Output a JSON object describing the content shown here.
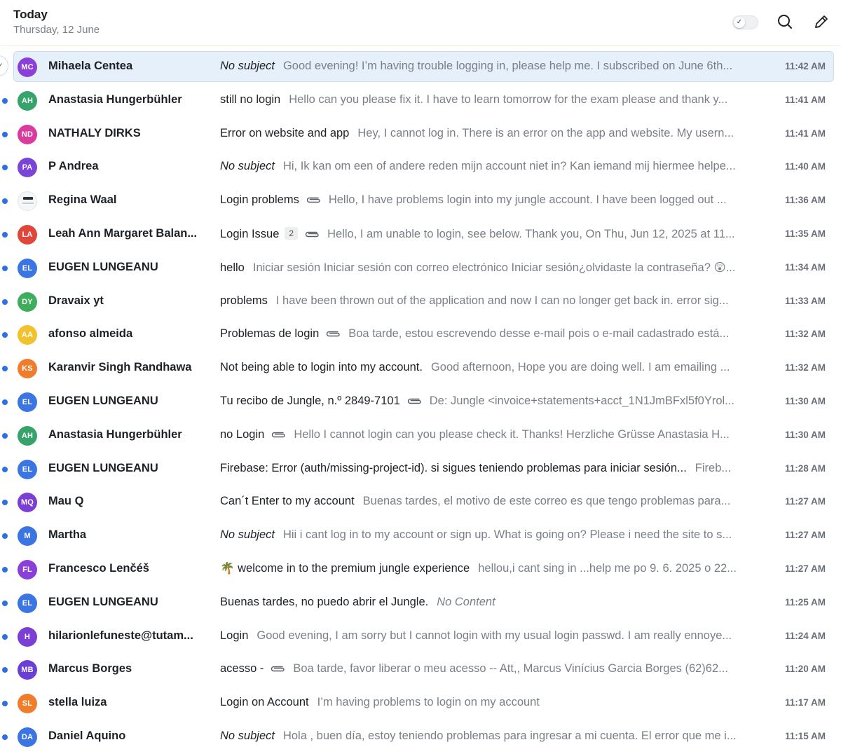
{
  "header": {
    "title": "Today",
    "date": "Thursday, 12 June",
    "toggle_icon": "check-icon",
    "actions": [
      "search-icon",
      "compose-icon"
    ]
  },
  "emails": [
    {
      "initials": "MC",
      "color": "#8b3fd9",
      "sender": "Mihaela Centea",
      "subject": "No subject",
      "subject_italic": true,
      "count": "",
      "attachment": false,
      "preview": "Good evening! I’m having trouble logging in, please help me. I subscribed on June 6th...",
      "time": "11:42 AM",
      "unread": false,
      "selected": true
    },
    {
      "initials": "AH",
      "color": "#35a36a",
      "sender": "Anastasia Hungerbühler",
      "subject": "still no login",
      "subject_italic": false,
      "count": "",
      "attachment": false,
      "preview": "Hello can you please fix it. I have to learn tomorrow for the exam please and thank y...",
      "time": "11:41 AM",
      "unread": true
    },
    {
      "initials": "ND",
      "color": "#d93c9e",
      "sender": "NATHALY DIRKS",
      "subject": "Error on website and app",
      "subject_italic": false,
      "count": "",
      "attachment": false,
      "preview": "Hey, I cannot log in. There is an error on the app and website. My usern...",
      "time": "11:41 AM",
      "unread": true
    },
    {
      "initials": "PA",
      "color": "#7a44d8",
      "sender": "P Andrea",
      "subject": "No subject",
      "subject_italic": true,
      "count": "",
      "attachment": false,
      "preview": "Hi, Ik kan om een of andere reden mijn account niet in? Kan iemand mij hiermee helpe...",
      "time": "11:40 AM",
      "unread": true
    },
    {
      "initials": "",
      "color": "",
      "sender": "Regina Waal",
      "subject": "Login problems",
      "subject_italic": false,
      "count": "",
      "attachment": true,
      "preview": "Hello, I have problems login into my jungle account. I have been logged out ...",
      "time": "11:36 AM",
      "unread": true,
      "avatar_image": true
    },
    {
      "initials": "LA",
      "color": "#e0473a",
      "sender": "Leah Ann Margaret Balan...",
      "subject": "Login Issue",
      "subject_italic": false,
      "count": "2",
      "attachment": true,
      "preview": "Hello, I am unable to login, see below. Thank you, On Thu, Jun 12, 2025 at 11...",
      "time": "11:35 AM",
      "unread": true
    },
    {
      "initials": "EL",
      "color": "#3b74e3",
      "sender": "EUGEN LUNGEANU",
      "subject": "hello",
      "subject_italic": false,
      "count": "",
      "attachment": false,
      "preview": "Iniciar sesión Iniciar sesión con correo electrónico Iniciar sesión¿olvidaste la contraseña? 😲...",
      "time": "11:34 AM",
      "unread": true
    },
    {
      "initials": "DY",
      "color": "#3fae5c",
      "sender": "Dravaix yt",
      "subject": "problems",
      "subject_italic": false,
      "count": "",
      "attachment": false,
      "preview": "I have been thrown out of the application and now I can no longer get back in. error sig...",
      "time": "11:33 AM",
      "unread": true
    },
    {
      "initials": "AA",
      "color": "#f2c12e",
      "sender": "afonso almeida",
      "subject": "Problemas de login",
      "subject_italic": false,
      "count": "",
      "attachment": true,
      "preview": "Boa tarde, estou escrevendo desse e-mail pois o e-mail cadastrado está...",
      "time": "11:32 AM",
      "unread": true
    },
    {
      "initials": "KS",
      "color": "#ef7d2c",
      "sender": "Karanvir Singh Randhawa",
      "subject": "Not being able to login into my account.",
      "subject_italic": false,
      "count": "",
      "attachment": false,
      "preview": "Good afternoon, Hope you are doing well. I am emailing ...",
      "time": "11:32 AM",
      "unread": true
    },
    {
      "initials": "EL",
      "color": "#3b74e3",
      "sender": "EUGEN LUNGEANU",
      "subject": "Tu recibo de Jungle, n.º 2849-7101",
      "subject_italic": false,
      "count": "",
      "attachment": true,
      "preview": "De: Jungle <invoice+statements+acct_1N1JmBFxl5f0Yrol...",
      "time": "11:30 AM",
      "unread": true
    },
    {
      "initials": "AH",
      "color": "#35a36a",
      "sender": "Anastasia Hungerbühler",
      "subject": "no Login",
      "subject_italic": false,
      "count": "",
      "attachment": true,
      "preview": "Hello I cannot login can you please check it. Thanks! Herzliche Grüsse Anastasia H...",
      "time": "11:30 AM",
      "unread": true
    },
    {
      "initials": "EL",
      "color": "#3b74e3",
      "sender": "EUGEN LUNGEANU",
      "subject": "Firebase: Error (auth/missing-project-id). si sigues teniendo problemas para iniciar sesión...",
      "subject_italic": false,
      "count": "",
      "attachment": false,
      "preview": "Fireb...",
      "time": "11:28 AM",
      "unread": true
    },
    {
      "initials": "MQ",
      "color": "#7c3fd6",
      "sender": "Mau Q",
      "subject": "Can´t Enter to my account",
      "subject_italic": false,
      "count": "",
      "attachment": false,
      "preview": "Buenas tardes, el motivo de este correo es que tengo problemas para...",
      "time": "11:27 AM",
      "unread": true
    },
    {
      "initials": "M",
      "color": "#3b74e3",
      "sender": "Martha",
      "subject": "No subject",
      "subject_italic": true,
      "count": "",
      "attachment": false,
      "preview": "Hii i cant log in to my account or sign up. What is going on? Please i need the site to s...",
      "time": "11:27 AM",
      "unread": true
    },
    {
      "initials": "FL",
      "color": "#8b3fd9",
      "sender": "Francesco Lenčéš",
      "subject": "🌴 welcome in to the premium jungle experience",
      "subject_italic": false,
      "count": "",
      "attachment": false,
      "preview": "hellou,i cant sing in ...help me po 9. 6. 2025 o 22...",
      "time": "11:27 AM",
      "unread": true
    },
    {
      "initials": "EL",
      "color": "#3b74e3",
      "sender": "EUGEN LUNGEANU",
      "subject": "Buenas tardes, no puedo abrir el Jungle.",
      "subject_italic": false,
      "count": "",
      "attachment": false,
      "preview": "No Content",
      "preview_italic": true,
      "time": "11:25 AM",
      "unread": true
    },
    {
      "initials": "H",
      "color": "#7c3fd6",
      "sender": "hilarionlefuneste@tutam...",
      "subject": "Login",
      "subject_italic": false,
      "count": "",
      "attachment": false,
      "preview": "Good evening, I am sorry but I cannot login with my usual login passwd. I am really ennoye...",
      "time": "11:24 AM",
      "unread": true
    },
    {
      "initials": "MB",
      "color": "#6a3fd6",
      "sender": "Marcus Borges",
      "subject": "acesso -",
      "subject_italic": false,
      "count": "",
      "attachment": true,
      "preview": "Boa tarde, favor liberar o meu acesso -- Att,, Marcus Vinícius Garcia Borges (62)62...",
      "time": "11:20 AM",
      "unread": true
    },
    {
      "initials": "SL",
      "color": "#ef7d2c",
      "sender": "stella luiza",
      "subject": "Login on Account",
      "subject_italic": false,
      "count": "",
      "attachment": false,
      "preview": "I’m having problems to login on my account",
      "time": "11:17 AM",
      "unread": true
    },
    {
      "initials": "DA",
      "color": "#3b74e3",
      "sender": "Daniel Aquino",
      "subject": "No subject",
      "subject_italic": true,
      "count": "",
      "attachment": false,
      "preview": "Hola , buen día, estoy teniendo problemas para ingresar a mi cuenta. El error que me i...",
      "time": "11:15 AM",
      "unread": true
    }
  ]
}
